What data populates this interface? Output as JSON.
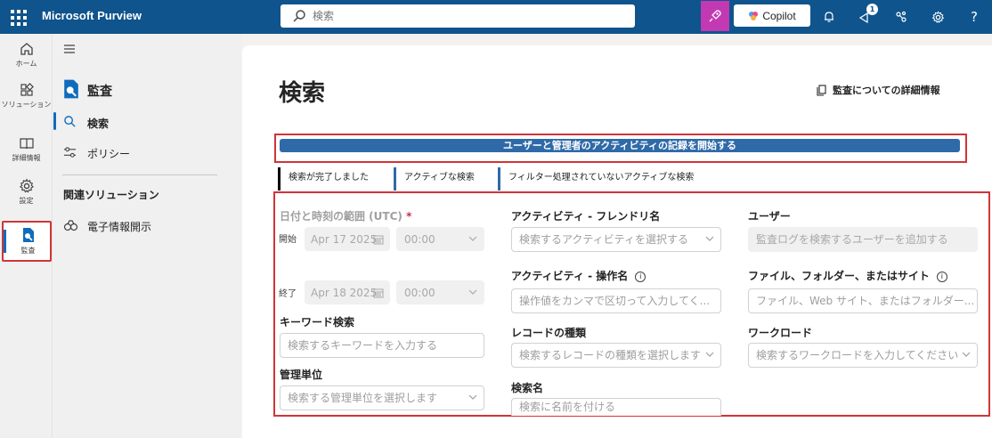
{
  "app": {
    "title": "Microsoft Purview"
  },
  "search": {
    "placeholder": "検索"
  },
  "topbar": {
    "copilot_label": "Copilot",
    "notification_count": "1",
    "help_label": "?"
  },
  "rail": [
    {
      "label": "ホーム",
      "icon": "home-icon"
    },
    {
      "label": "ソリューション",
      "icon": "solutions-icon"
    },
    {
      "label": "詳細情報",
      "icon": "learn-icon"
    },
    {
      "label": "設定",
      "icon": "settings-icon"
    },
    {
      "label": "監査",
      "icon": "audit-icon",
      "active": true
    }
  ],
  "subnav": {
    "title": "監査",
    "items": [
      {
        "label": "検索",
        "icon": "search-icon",
        "selected": true
      },
      {
        "label": "ポリシー",
        "icon": "policy-icon"
      }
    ],
    "section_header": "関連ソリューション",
    "related": [
      {
        "label": "電子情報開示",
        "icon": "ediscovery-icon"
      }
    ]
  },
  "main": {
    "page_title": "検索",
    "learn_more": "監査についての詳細情報",
    "start_button": "ユーザーと管理者のアクティビティの記録を開始する",
    "tabs": [
      {
        "label": "検索が完了しました",
        "active": true
      },
      {
        "label": "アクティブな検索"
      },
      {
        "label": "フィルター処理されていないアクティブな検索"
      }
    ],
    "form": {
      "date_range_label": "日付と時刻の範囲 (UTC)",
      "required_mark": "*",
      "start_label": "開始",
      "start_date": "Apr 17 2025",
      "start_time": "00:00",
      "end_label": "終了",
      "end_date": "Apr 18 2025",
      "end_time": "00:00",
      "keyword_label": "キーワード検索",
      "keyword_placeholder": "検索するキーワードを入力する",
      "admin_units_label": "管理単位",
      "admin_units_placeholder": "検索する管理単位を選択します",
      "activity_friendly_label": "アクティビティ - フレンドリ名",
      "activity_friendly_placeholder": "検索するアクティビティを選択する",
      "activity_op_label": "アクティビティ - 操作名",
      "activity_op_placeholder": "操作値をカンマで区切って入力してく...",
      "record_type_label": "レコードの種類",
      "record_type_placeholder": "検索するレコードの種類を選択します",
      "search_name_label": "検索名",
      "search_name_placeholder": "検索に名前を付ける",
      "users_label": "ユーザー",
      "users_placeholder": "監査ログを検索するユーザーを追加する",
      "files_label": "ファイル、フォルダー、またはサイト",
      "files_placeholder": "ファイル、Web サイト、またはフォルダー...",
      "workload_label": "ワークロード",
      "workload_placeholder": "検索するワークロードを入力してください"
    }
  },
  "colors": {
    "topbar": "#0f548c",
    "accent": "#0f6cbd",
    "highlight_border": "#d13438",
    "copilot_pink": "#c239b3"
  }
}
